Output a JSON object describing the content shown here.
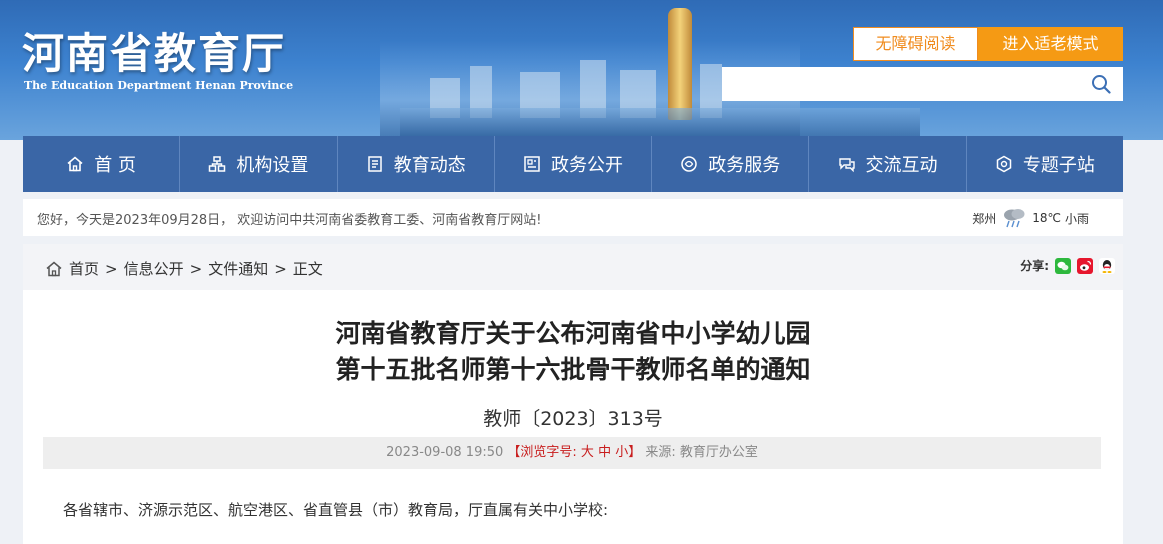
{
  "header": {
    "title": "河南省教育厅",
    "subtitle": "The Education Department Henan Province",
    "accessibility_label": "无障碍阅读",
    "elder_mode_label": "进入适老模式",
    "search_placeholder": ""
  },
  "nav": {
    "items": [
      {
        "label": "首 页",
        "icon": "home-icon"
      },
      {
        "label": "机构设置",
        "icon": "org-icon"
      },
      {
        "label": "教育动态",
        "icon": "news-icon"
      },
      {
        "label": "政务公开",
        "icon": "doc-icon"
      },
      {
        "label": "政务服务",
        "icon": "service-icon"
      },
      {
        "label": "交流互动",
        "icon": "chat-icon"
      },
      {
        "label": "专题子站",
        "icon": "topic-icon"
      }
    ]
  },
  "welcome": {
    "text": "您好，今天是2023年09月28日， 欢迎访问中共河南省委教育工委、河南省教育厅网站!",
    "city": "郑州",
    "temperature": "18℃",
    "condition": "小雨"
  },
  "breadcrumb": {
    "items": [
      "首页",
      "信息公开",
      "文件通知"
    ],
    "current": "正文",
    "share_label": "分享:"
  },
  "article": {
    "title_line1": "河南省教育厅关于公布河南省中小学幼儿园",
    "title_line2": "第十五批名师第十六批骨干教师名单的通知",
    "doc_number": "教师〔2023〕313号",
    "date": "2023-09-08 19:50",
    "font_size_label": "【浏览字号: 大 中 小】",
    "source": "来源: 教育厅办公室",
    "body_first_line": "各省辖市、济源示范区、航空港区、省直管县（市）教育局，厅直属有关中小学校:"
  },
  "colors": {
    "nav_bg": "#3a66a6",
    "accent_orange": "#f59a14",
    "header_blue": "#2f6bb6"
  }
}
